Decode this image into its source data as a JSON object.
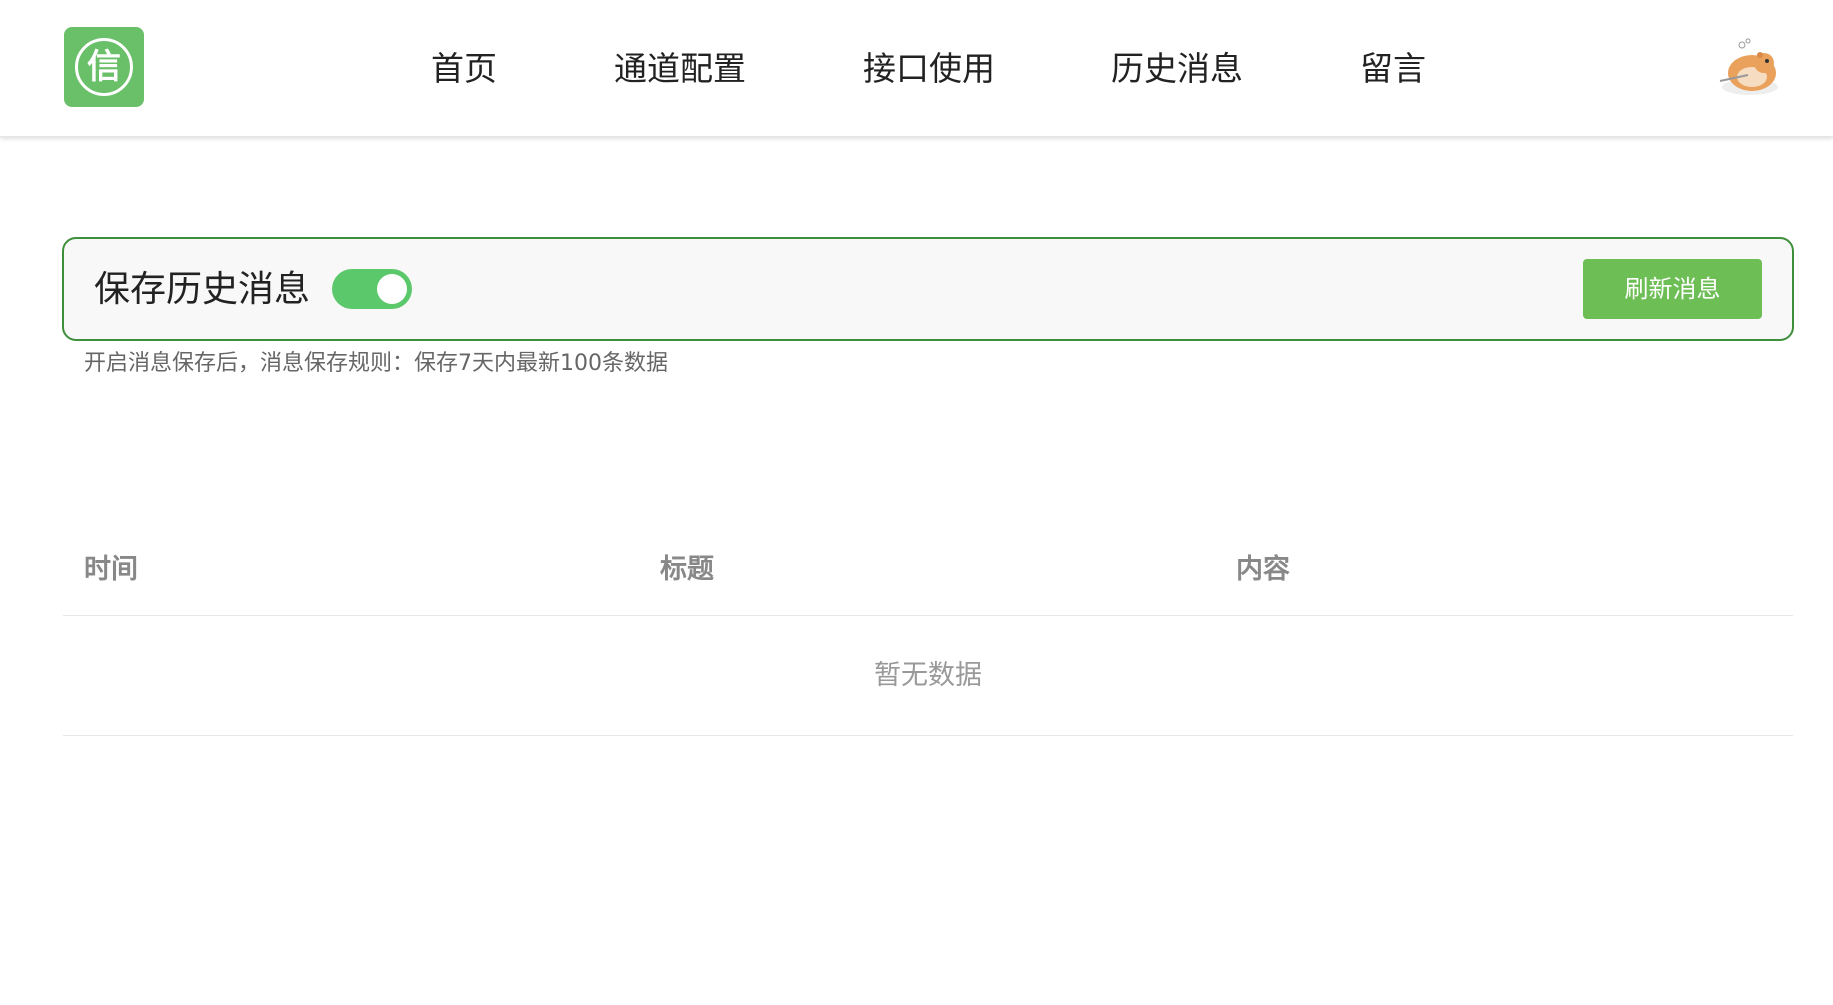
{
  "header": {
    "logo_glyph": "信",
    "nav": [
      {
        "label": "首页"
      },
      {
        "label": "通道配置"
      },
      {
        "label": "接口使用"
      },
      {
        "label": "历史消息"
      },
      {
        "label": "留言"
      }
    ]
  },
  "history": {
    "title": "保存历史消息",
    "toggle_on": true,
    "refresh_label": "刷新消息",
    "note": "开启消息保存后，消息保存规则：保存7天内最新100条数据"
  },
  "table": {
    "columns": [
      "时间",
      "标题",
      "内容"
    ],
    "rows": [],
    "empty_text": "暂无数据"
  },
  "colors": {
    "brand_green": "#6abf69",
    "switch_on": "#5cc86c",
    "button_green": "#6dbe55",
    "panel_border": "#3d8f3a"
  }
}
